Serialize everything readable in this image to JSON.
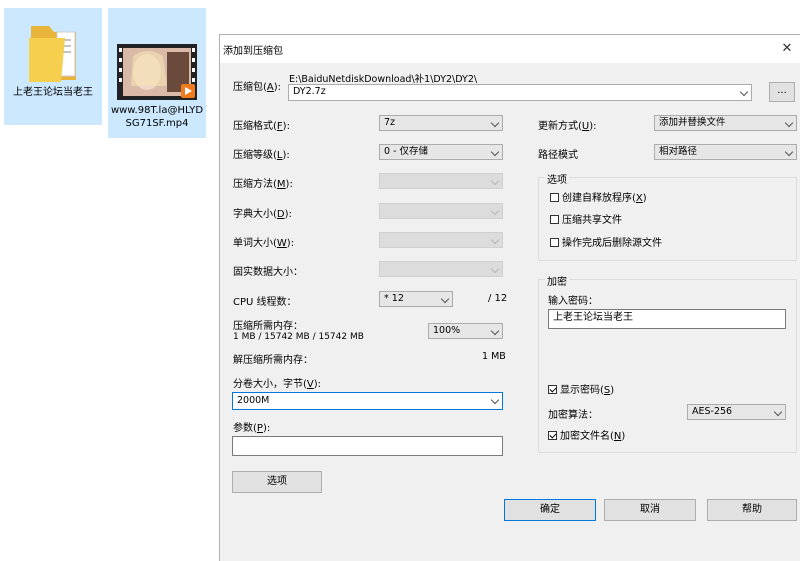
{
  "desktop": {
    "folder_label": "上老王论坛当老王",
    "video_label": "www.98T.la@HLYDSG71SF.mp4"
  },
  "dialog": {
    "title": "添加到压缩包",
    "archive_label": "压缩包(",
    "archive_key": "A",
    "archive_tail": "):",
    "archive_path": "E:\\BaiduNetdiskDownload\\补1\\DY2\\DY2\\",
    "archive_name": "DY2.7z",
    "browse_label": "...",
    "format_label": "压缩格式(",
    "format_key": "F",
    "format_tail": "):",
    "format_value": "7z",
    "level_label": "压缩等级(",
    "level_key": "L",
    "level_tail": "):",
    "level_value": "0 - 仅存储",
    "method_label": "压缩方法(",
    "method_key": "M",
    "method_tail": "):",
    "dict_label": "字典大小(",
    "dict_key": "D",
    "dict_tail": "):",
    "word_label": "单词大小(",
    "word_key": "W",
    "word_tail": "):",
    "solid_label": "固实数据大小：",
    "cpu_label": "CPU 线程数：",
    "cpu_value": "* 12",
    "cpu_total": "/ 12",
    "mem_label": "压缩所需内存：",
    "mem_detail": "1 MB / 15742 MB / 15742 MB",
    "mem_percent": "100%",
    "decomp_label": "解压缩所需内存：",
    "decomp_value": "1 MB",
    "volume_label": "分卷大小，字节(",
    "volume_key": "V",
    "volume_tail": "):",
    "volume_value": "2000M",
    "params_label": "参数(",
    "params_key": "P",
    "params_tail": "):",
    "params_value": "",
    "options_button": "选项",
    "update_label": "更新方式(",
    "update_key": "U",
    "update_tail": "):",
    "update_value": "添加并替换文件",
    "path_label": "路径模式",
    "path_value": "相对路径",
    "options_group": "选项",
    "opt_sfx": "创建自释放程序(",
    "opt_sfx_key": "X",
    "opt_sfx_tail": ")",
    "opt_shared": "压缩共享文件",
    "opt_delete": "操作完成后删除源文件",
    "encrypt_group": "加密",
    "password_label": "输入密码：",
    "password_value": "上老王论坛当老王",
    "show_pwd": "显示密码(",
    "show_pwd_key": "S",
    "show_pwd_tail": ")",
    "enc_method_label": "加密算法：",
    "enc_method_value": "AES-256",
    "enc_names": "加密文件名(",
    "enc_names_key": "N",
    "enc_names_tail": ")",
    "ok": "确定",
    "cancel": "取消",
    "help": "帮助"
  }
}
